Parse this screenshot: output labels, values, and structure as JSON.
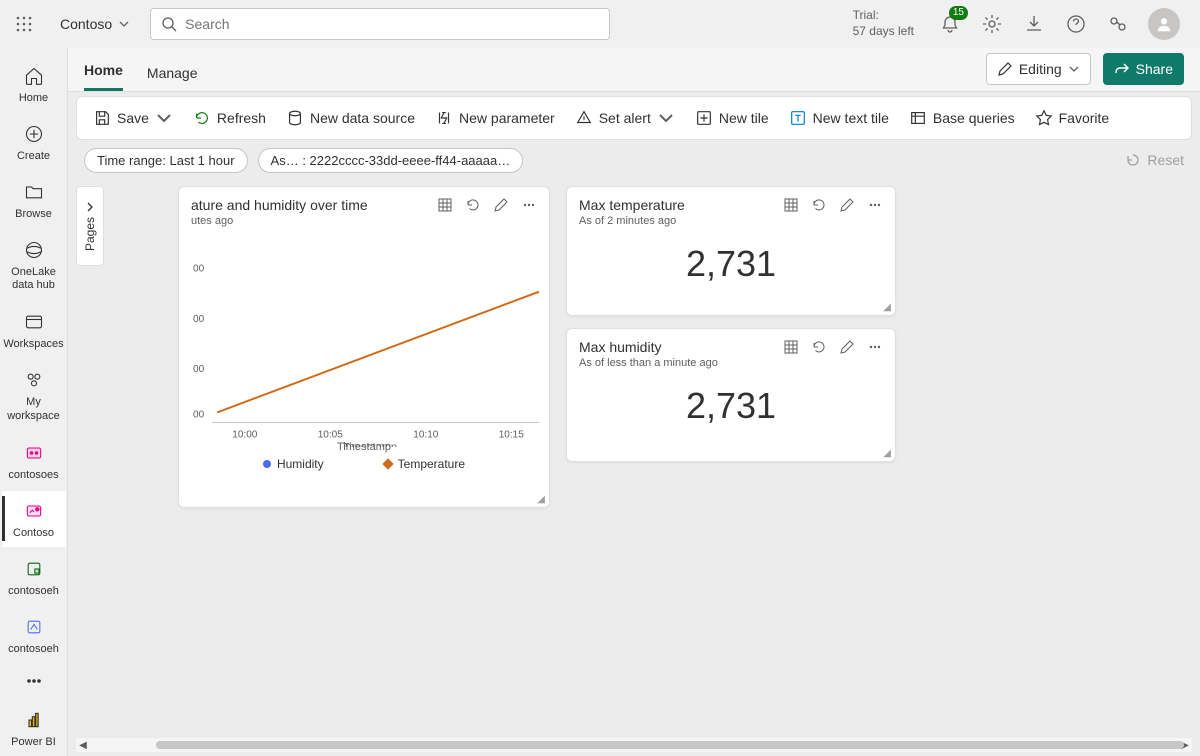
{
  "top": {
    "workspace": "Contoso",
    "search_placeholder": "Search",
    "trial_line1": "Trial:",
    "trial_line2": "57 days left",
    "notif_badge": "15"
  },
  "rail": [
    {
      "label": "Home"
    },
    {
      "label": "Create"
    },
    {
      "label": "Browse"
    },
    {
      "label": "OneLake data hub"
    },
    {
      "label": "Workspaces"
    },
    {
      "label": "My workspace"
    },
    {
      "label": "contosoes"
    },
    {
      "label": "Contoso"
    },
    {
      "label": "contosoeh"
    },
    {
      "label": "contosoeh"
    },
    {
      "label": "Power BI"
    }
  ],
  "tabs": {
    "home": "Home",
    "manage": "Manage"
  },
  "tabactions": {
    "editing": "Editing",
    "share": "Share"
  },
  "ribbon": {
    "save": "Save",
    "refresh": "Refresh",
    "newds": "New data source",
    "newparam": "New parameter",
    "setalert": "Set alert",
    "newtile": "New tile",
    "newtext": "New text tile",
    "base": "Base queries",
    "favorite": "Favorite"
  },
  "chips": {
    "timerange": "Time range: Last 1 hour",
    "asset": "As… : 2222cccc-33dd-eeee-ff44-aaaaa…",
    "reset": "Reset"
  },
  "tiles": {
    "t1": {
      "title": "ature and humidity over time",
      "sub": "utes ago"
    },
    "t2": {
      "title": "Max temperature",
      "sub": "As of 2 minutes ago",
      "value": "2,731"
    },
    "t3": {
      "title": "Max humidity",
      "sub": "As of less than a minute ago",
      "value": "2,731"
    }
  },
  "chart_data": {
    "type": "line",
    "title": "Temperature and humidity over time",
    "xlabel": "Timestamp",
    "ylabel": "",
    "categories": [
      "10:00",
      "10:05",
      "10:10",
      "10:15"
    ],
    "series": [
      {
        "name": "Humidity",
        "values": [
          null,
          null,
          null,
          null
        ]
      },
      {
        "name": "Temperature",
        "values": [
          200,
          350,
          500,
          650
        ]
      }
    ],
    "ylim": [
      0,
      800
    ]
  },
  "pages_label": "Pages"
}
